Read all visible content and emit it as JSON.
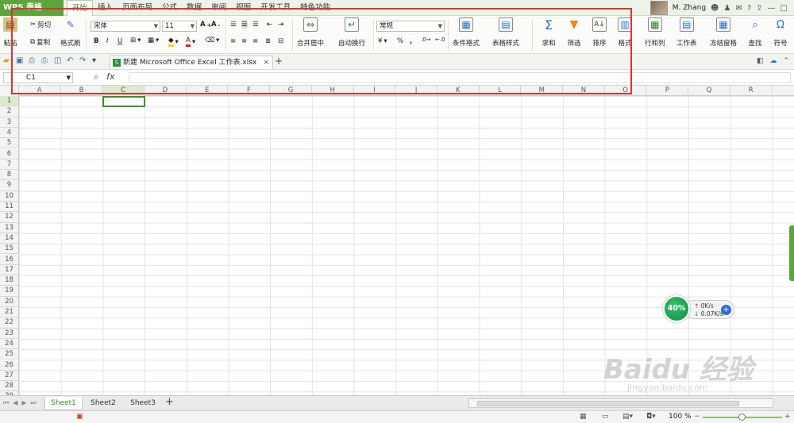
{
  "app": {
    "menu_label": "WPS 表格"
  },
  "tabs": [
    {
      "label": "开始",
      "active": true
    },
    {
      "label": "插入"
    },
    {
      "label": "页面布局"
    },
    {
      "label": "公式"
    },
    {
      "label": "数据"
    },
    {
      "label": "审阅"
    },
    {
      "label": "视图"
    },
    {
      "label": "开发工具"
    },
    {
      "label": "特色功能"
    }
  ],
  "user": {
    "name": "M. Zhang",
    "help": "?"
  },
  "ribbon": {
    "paste": "粘贴",
    "cut": "剪切",
    "copy": "复制",
    "format_painter": "格式刷",
    "font_name": "宋体",
    "font_size": "11",
    "bold": "B",
    "italic": "I",
    "underline": "U",
    "merge_center": "合并居中",
    "wrap_text": "自动换行",
    "number_format": "常规",
    "percent": "%",
    "thousands": ",",
    "inc_dec": ".0\n.00",
    "cond_format": "条件格式",
    "table_style": "表格样式",
    "sum": "求和",
    "filter": "筛选",
    "sort": "排序",
    "format": "格式",
    "row_col": "行和列",
    "worksheet": "工作表",
    "freeze": "冻结窗格",
    "find": "查找",
    "symbol": "符号"
  },
  "document": {
    "tab_title": "新建 Microsoft Office Excel 工作表.xlsx",
    "close": "×",
    "new_tab": "+"
  },
  "formula_bar": {
    "name_box": "C1",
    "fx": "fx",
    "formula": ""
  },
  "grid": {
    "columns": [
      "A",
      "B",
      "C",
      "D",
      "E",
      "F",
      "G",
      "H",
      "I",
      "J",
      "K",
      "L",
      "M",
      "N",
      "O",
      "P",
      "Q",
      "R"
    ],
    "rows": [
      "1",
      "2",
      "3",
      "4",
      "5",
      "6",
      "7",
      "8",
      "9",
      "10",
      "11",
      "12",
      "13",
      "14",
      "15",
      "16",
      "17",
      "18",
      "19",
      "20",
      "21",
      "22",
      "23",
      "24",
      "25",
      "26",
      "27",
      "28",
      "29"
    ],
    "selected_col": "C",
    "selected_row": "1"
  },
  "sheets": [
    {
      "label": "Sheet1",
      "active": true
    },
    {
      "label": "Sheet2"
    },
    {
      "label": "Sheet3"
    }
  ],
  "add_sheet": "+",
  "status": {
    "zoom": "100 %"
  },
  "net_widget": {
    "percent": "40%",
    "up": "0K/s",
    "down": "0.07K/s",
    "plus": "+"
  },
  "watermark": {
    "brand": "Baidu 经验",
    "url": "jingyan.baidu.com"
  },
  "colors": {
    "accent": "#5aa63a",
    "selection": "#3e8e28",
    "annotation": "#e03030"
  }
}
